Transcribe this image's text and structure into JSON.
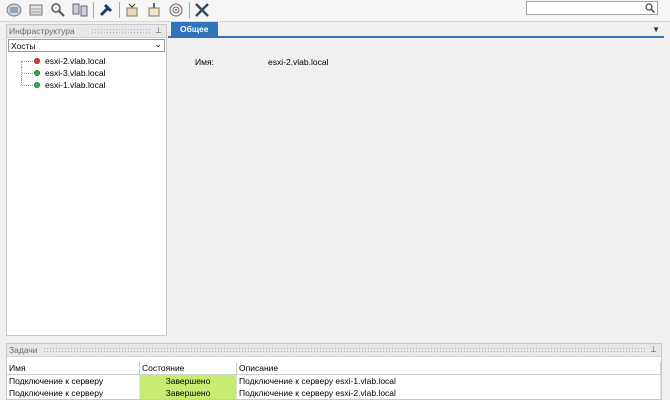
{
  "search": {
    "value": ""
  },
  "toolbar": {
    "buttons": [
      "hosts-icon",
      "datastore-icon",
      "magnifier-icon",
      "network-icon",
      "connect-icon",
      "deploy-icon",
      "package-icon",
      "target-icon",
      "tools-icon"
    ]
  },
  "infrastructure": {
    "title": "Инфраструктура",
    "selector": "Хосты",
    "hosts": [
      {
        "name": "esxi-2.vlab.local",
        "status_color": "#e53935"
      },
      {
        "name": "esxi-3.vlab.local",
        "status_color": "#2fb24a"
      },
      {
        "name": "esxi-1.vlab.local",
        "status_color": "#2fb24a"
      }
    ]
  },
  "main": {
    "tab": "Общее",
    "name_label": "Имя:",
    "name_value": "esxi-2.vlab.local"
  },
  "tasks": {
    "title": "Задачи",
    "columns": [
      "Имя",
      "Состояние",
      "Описание"
    ],
    "rows": [
      {
        "name": "Подключение к серверу",
        "state": "Завершено",
        "description": "Подключение к серверу esxi-1.vlab.local"
      },
      {
        "name": "Подключение к серверу",
        "state": "Завершено",
        "description": "Подключение к серверу esxi-2.vlab.local"
      }
    ]
  },
  "colors": {
    "accent": "#2f73b9",
    "completed": "#c6ec72"
  }
}
